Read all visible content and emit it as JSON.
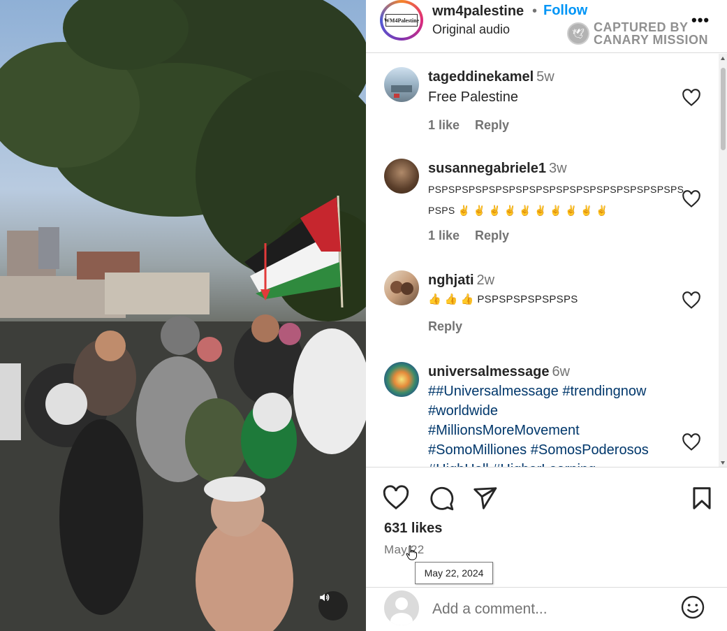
{
  "post": {
    "owner": "wm4palestine",
    "owner_logo_text": "WM4Palestine",
    "separator": "•",
    "follow_label": "Follow",
    "audio": "Original audio",
    "more_label": "•••"
  },
  "watermark": {
    "line1": "CAPTURED BY",
    "line2": "CANARY MISSION"
  },
  "comments": [
    {
      "user": "tageddinekamel",
      "time": "5w",
      "text": "Free Palestine",
      "likes": "1 like",
      "reply": "Reply"
    },
    {
      "user": "susannegabriele1",
      "time": "3w",
      "text_line1": "PSPSPSPSPSPSPSPSPSPSPSPSPSPSPSPSPSPSPS",
      "text_line2": "PSPS ✌️ ✌️ ✌️ ✌️ ✌️ ✌️ ✌️ ✌️ ✌️ ✌️",
      "likes": "1 like",
      "reply": "Reply"
    },
    {
      "user": "nghjati",
      "time": "2w",
      "text": "👍 👍 👍 PSPSPSPSPSPSPS",
      "reply": "Reply"
    },
    {
      "user": "universalmessage",
      "time": "6w",
      "lines": [
        "##Universalmessage #trendingnow",
        "#worldwide",
        "#MillionsMoreMovement",
        "#SomoMilliones #SomosPoderosos",
        "#HighHall #HigherLearning"
      ]
    }
  ],
  "actions": {
    "likes": "631 likes",
    "date": "May 22",
    "tooltip": "May 22, 2024"
  },
  "add_comment": {
    "placeholder": "Add a comment..."
  },
  "icons": [
    "heart-icon",
    "comment-icon",
    "share-icon",
    "bookmark-icon",
    "emoji-icon",
    "volume-icon"
  ]
}
